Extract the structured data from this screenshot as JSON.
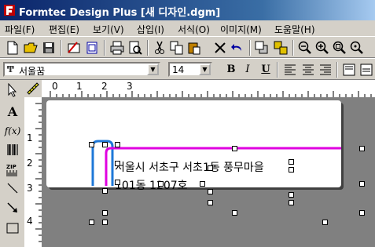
{
  "window": {
    "title": "Formtec Design Plus [새 디자인.dgm]"
  },
  "menu": [
    {
      "label": "파일(F)"
    },
    {
      "label": "편집(E)"
    },
    {
      "label": "보기(V)"
    },
    {
      "label": "삽입(I)"
    },
    {
      "label": "서식(O)"
    },
    {
      "label": "이미지(M)"
    },
    {
      "label": "도움말(H)"
    }
  ],
  "format_toolbar": {
    "font_name": "서울꿈",
    "font_size": "14",
    "bold": "B",
    "italic": "I",
    "underline": "U"
  },
  "rulers": {
    "horizontal": [
      "0",
      "1",
      "2",
      "3"
    ],
    "vertical": [
      "1",
      "2",
      "3",
      "4"
    ]
  },
  "label_text": {
    "line1": "서울시 서초구 서초1동 풍무마을",
    "line2": "101동 1207호"
  },
  "colors": {
    "accent_magenta": "#e000e0",
    "accent_blue": "#1e78d8",
    "title_bar": "#0a246a"
  }
}
